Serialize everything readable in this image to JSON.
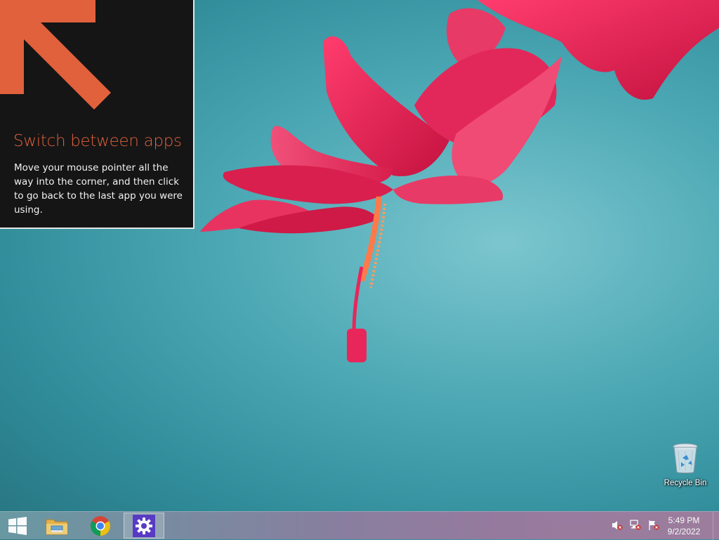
{
  "tip": {
    "title": "Switch between apps",
    "body": "Move your mouse pointer all the way into the corner, and then click to go back to the last app you were using.",
    "accent_color": "#e0613c"
  },
  "desktop": {
    "icons": [
      {
        "label": "Recycle Bin",
        "icon": "recycle-bin-icon"
      }
    ]
  },
  "taskbar": {
    "buttons": [
      {
        "name": "Start",
        "icon": "windows-logo-icon"
      },
      {
        "name": "File Explorer",
        "icon": "folder-icon"
      },
      {
        "name": "Google Chrome",
        "icon": "chrome-icon"
      },
      {
        "name": "Settings",
        "icon": "gear-icon",
        "active": true
      }
    ],
    "tray": [
      {
        "icon": "volume-muted-icon"
      },
      {
        "icon": "network-disconnected-icon"
      },
      {
        "icon": "action-center-flag-icon"
      }
    ],
    "clock": {
      "time": "5:49 PM",
      "date": "9/2/2022"
    }
  },
  "colors": {
    "wallpaper_teal": "#4aa7b3",
    "flower_pink": "#e8265a",
    "tip_background": "#151515"
  }
}
